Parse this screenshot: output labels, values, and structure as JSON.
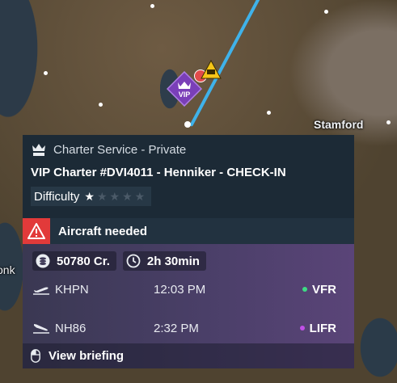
{
  "map": {
    "city_label": "Stamford",
    "edge_label": "onk"
  },
  "marker": {
    "vip_text": "VIP"
  },
  "card": {
    "service": "Charter Service - Private",
    "title": "VIP Charter #DVI4011 - Henniker - CHECK-IN",
    "difficulty_label": "Difficulty",
    "difficulty_rating": 1,
    "difficulty_max": 5,
    "alert_text": "Aircraft needed",
    "reward": "50780 Cr.",
    "duration": "2h 30min",
    "departure": {
      "code": "KHPN",
      "time": "12:03 PM",
      "condition": "VFR",
      "condition_color": "#3ddc84"
    },
    "arrival": {
      "code": "NH86",
      "time": "2:32 PM",
      "condition": "LIFR",
      "condition_color": "#c150e8"
    },
    "briefing_label": "View briefing"
  },
  "colors": {
    "alert": "#e23a3a",
    "route": "#3fb2ea",
    "vip_purple": "#7a3fb8"
  }
}
